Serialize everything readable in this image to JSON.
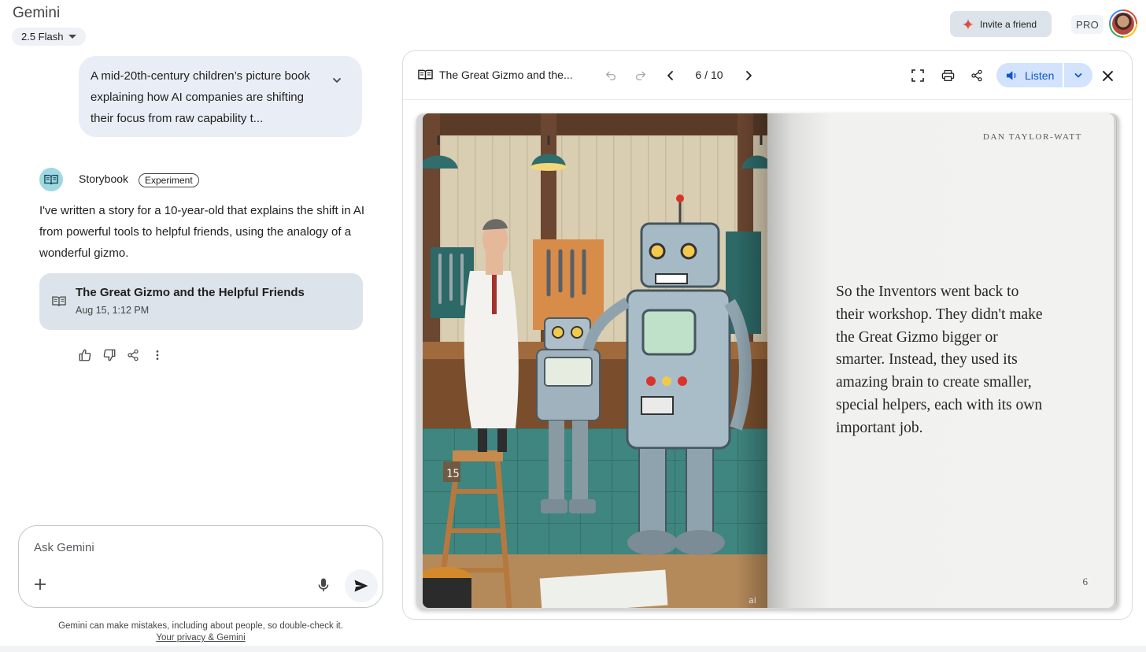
{
  "header": {
    "app_title": "Gemini",
    "model_label": "2.5 Flash",
    "invite_label": "Invite a friend",
    "pro_label": "PRO"
  },
  "chat": {
    "user_prompt": "A mid-20th-century children’s picture book explaining how AI companies are shifting their focus from raw capability t...",
    "agent_name": "Storybook",
    "agent_badge": "Experiment",
    "response_text": "I've written a story for a 10-year-old that explains the shift in AI from powerful tools to helpful friends, using the analogy of a wonderful gizmo.",
    "story_card": {
      "title": "The Great Gizmo and the Helpful Friends",
      "date": "Aug 15, 1:12 PM"
    }
  },
  "input": {
    "placeholder": "Ask Gemini"
  },
  "footer": {
    "disclaimer": "Gemini can make mistakes, including about people, so double-check it.",
    "privacy_link": "Your privacy & Gemini"
  },
  "panel": {
    "title": "The Great Gizmo and the...",
    "page_indicator": "6 / 10",
    "listen_label": "Listen",
    "book": {
      "author": "DAN TAYLOR-WATT",
      "page_text": "So the Inventors went back to their workshop. They didn't make the Great Gizmo bigger or smarter. Instead, they used its amazing brain to create smaller, special helpers, each with its own important job.",
      "page_number": "6",
      "illustration_stool_number": "15",
      "illustration_watermark": "ai"
    }
  },
  "colors": {
    "accent_blue": "#0b57d0",
    "listen_bg": "#d3e3fd",
    "bubble_bg": "#e9eef6",
    "card_bg": "#dde3ea"
  }
}
